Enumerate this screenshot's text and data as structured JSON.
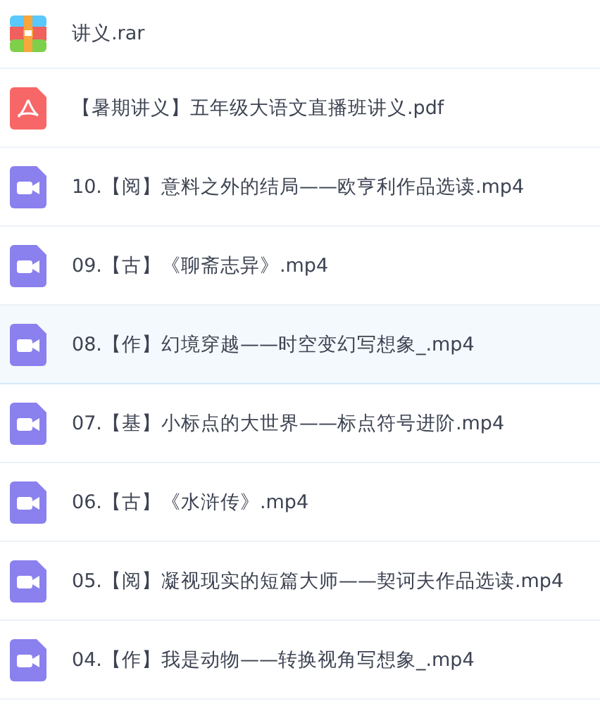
{
  "files": [
    {
      "kind": "archive",
      "name": "讲义.rar",
      "selected": false
    },
    {
      "kind": "pdf",
      "name": "【暑期讲义】五年级大语文直播班讲义.pdf",
      "selected": false
    },
    {
      "kind": "video",
      "name": "10.【阅】意料之外的结局——欧亨利作品选读.mp4",
      "selected": false
    },
    {
      "kind": "video",
      "name": "09.【古】《聊斋志异》.mp4",
      "selected": false
    },
    {
      "kind": "video",
      "name": "08.【作】幻境穿越——时空变幻写想象_.mp4",
      "selected": true
    },
    {
      "kind": "video",
      "name": "07.【基】小标点的大世界——标点符号进阶.mp4",
      "selected": false
    },
    {
      "kind": "video",
      "name": "06.【古】《水浒传》.mp4",
      "selected": false
    },
    {
      "kind": "video",
      "name": "05.【阅】凝视现实的短篇大师——契诃夫作品选读.mp4",
      "selected": false
    },
    {
      "kind": "video",
      "name": "04.【作】我是动物——转换视角写想象_.mp4",
      "selected": false
    }
  ]
}
